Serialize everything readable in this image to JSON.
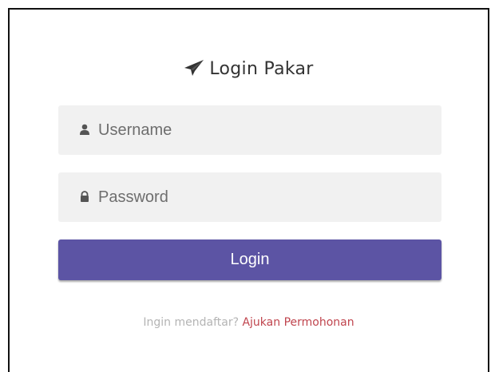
{
  "header": {
    "title": "Login Pakar"
  },
  "form": {
    "username_placeholder": "Username",
    "password_placeholder": "Password",
    "login_label": "Login"
  },
  "footer": {
    "question": "Ingin mendaftar?",
    "link_label": "Ajukan Permohonan"
  },
  "colors": {
    "button": "#5c54a4",
    "link": "#c0454e",
    "field_bg": "#f1f1f1"
  },
  "icons": {
    "title": "paper-plane-icon",
    "username": "user-icon",
    "password": "lock-icon"
  }
}
